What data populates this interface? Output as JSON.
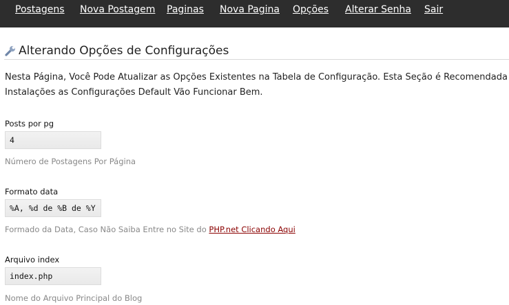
{
  "nav": {
    "items": [
      {
        "label": "Postagens"
      },
      {
        "label": "Nova Postagem"
      },
      {
        "label": "Paginas"
      },
      {
        "label": "Nova Pagina"
      },
      {
        "label": "Opções"
      },
      {
        "label": "Alterar Senha"
      },
      {
        "label": "Sair"
      }
    ]
  },
  "page": {
    "title_icon": "wrench-icon",
    "title": "Alterando Opções de Configurações",
    "intro_line1": "Nesta Página, Você Pode Atualizar as Opções Existentes na Tabela de Configuração. Esta Seção é Recomendada A",
    "intro_line2": "Instalações as Configurações Default Vão Funcionar Bem."
  },
  "fields": [
    {
      "label": "Posts por pg",
      "value": "4",
      "help": "Número de Postagens Por Página"
    },
    {
      "label": "Formato data",
      "value": "%A, %d de %B de %Y",
      "help_prefix": "Formado da Data, Caso Não Saiba Entre no Site do ",
      "help_link": "PHP.net Clicando Aqui"
    },
    {
      "label": "Arquivo index",
      "value": "index.php",
      "help": "Nome do Arquivo Principal do Blog"
    }
  ],
  "colors": {
    "nav_bg": "#2d2d2d",
    "link_red": "#8a0000"
  }
}
